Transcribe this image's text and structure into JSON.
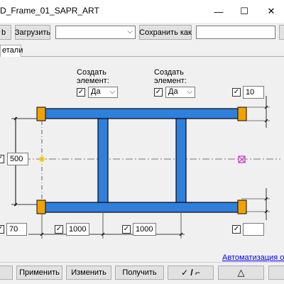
{
  "window": {
    "title": "D_Frame_01_SAPR_ART",
    "minimize_glyph": "—",
    "maximize_glyph": "☐",
    "close_glyph": "✕"
  },
  "toolbar": {
    "partial_button_label": "b",
    "load_label": "Загрузить",
    "preset_value": "",
    "save_as_label": "Сохранить как",
    "save_name_value": ""
  },
  "tabs": [
    {
      "label": "етали"
    }
  ],
  "create_element": [
    {
      "label_line1": "Создать",
      "label_line2": "элемент:",
      "value": "Да",
      "checked": true
    },
    {
      "label_line1": "Создать",
      "label_line2": "элемент:",
      "value": "Да",
      "checked": true
    }
  ],
  "dimensions": {
    "top_right": "10",
    "height": "500",
    "bottom_left": "70",
    "span_1": "1000",
    "span_2": "1000",
    "bottom_right": ""
  },
  "link_text": "Автоматизация от S",
  "bottom_buttons": {
    "partial": "",
    "apply": "Применить",
    "change": "Изменить",
    "get": "Получить",
    "toggle": "✓ / ⌐",
    "triangle": "△"
  },
  "colors": {
    "member_fill": "#2f7fdc",
    "member_stroke": "#0a0a0a",
    "cap_fill": "#f2a200",
    "node_marker": "#cc33cc",
    "axis_marker": "#f4d000"
  }
}
